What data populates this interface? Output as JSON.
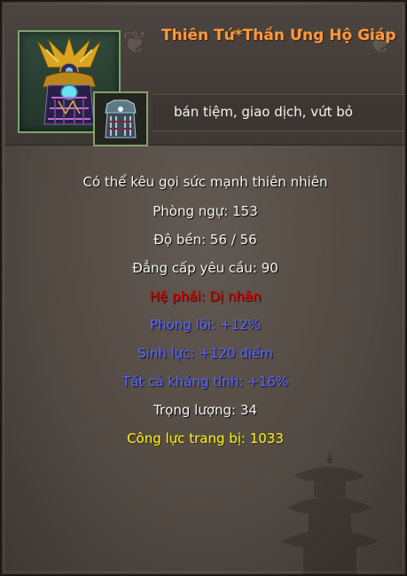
{
  "item": {
    "name": "Thiên Tứ*Thần Ưng Hộ Giáp",
    "restrictions": "bán tiệm, giao dịch, vứt bỏ",
    "icon": "armor-icon",
    "sub_icon": "equipped-armor-icon"
  },
  "stats": {
    "description": "Có thể kêu gọi sức mạnh thiên nhiên",
    "defense": "Phòng ngự: 153",
    "durability": "Độ bền:  56 /  56",
    "level_req": "Đẳng cấp yêu cầu: 90",
    "faction": "Hệ phái: Dị nhân",
    "lightning_res": "Phòng lôi: +12%",
    "life": "Sinh lực: +120 điểm",
    "all_res": "Tất cả kháng tính: +16%",
    "weight": "Trọng lượng: 34",
    "power": "Công lực trang bị: 1033"
  },
  "colors": {
    "title": "#ff9a3c",
    "normal": "#f4f4f4",
    "faction": "#e10000",
    "bonus": "#5b68ff",
    "power": "#fff21a"
  }
}
